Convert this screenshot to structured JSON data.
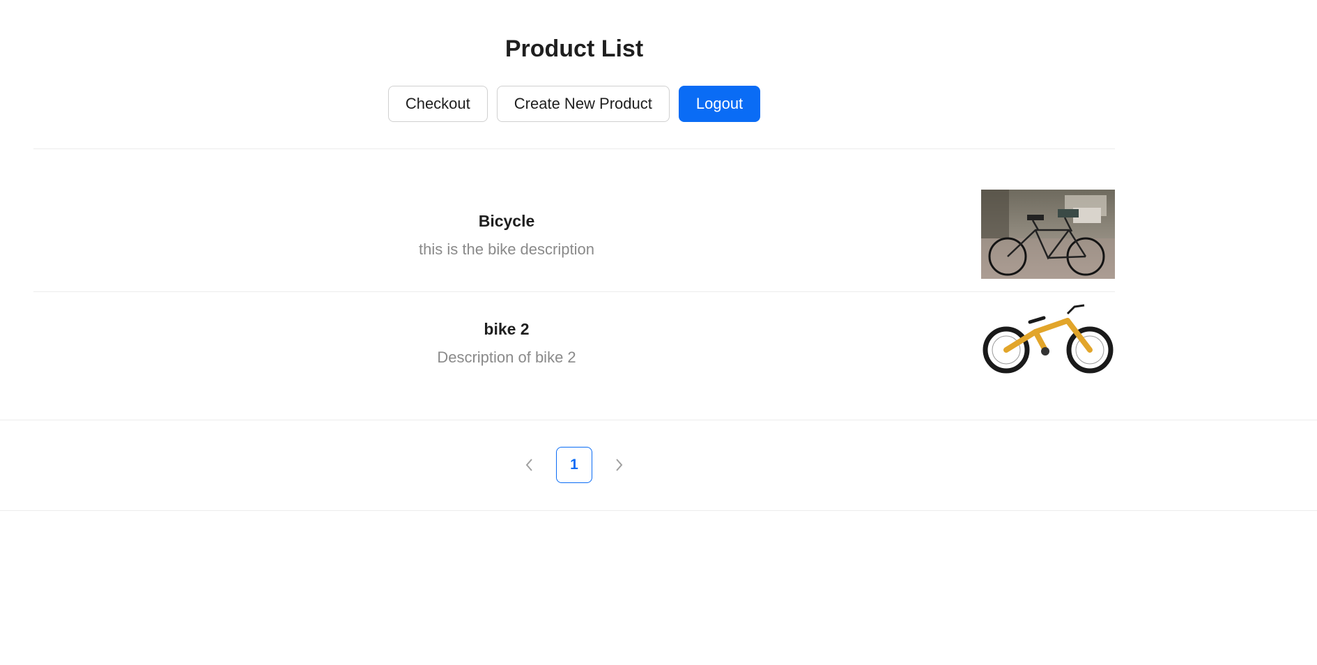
{
  "header": {
    "title": "Product List",
    "buttons": {
      "checkout": "Checkout",
      "create": "Create New Product",
      "logout": "Logout"
    }
  },
  "products": [
    {
      "name": "Bicycle",
      "description": "this is the bike description",
      "image": "black-city-bicycle-photo"
    },
    {
      "name": "bike 2",
      "description": "Description of bike 2",
      "image": "yellow-mountain-bike-photo"
    }
  ],
  "pagination": {
    "current_page": "1",
    "prev_icon": "chevron-left-icon",
    "next_icon": "chevron-right-icon"
  },
  "colors": {
    "primary": "#0a6cf5",
    "text": "#1f1f1f",
    "muted": "#8a8a8a",
    "divider": "#ececec"
  }
}
